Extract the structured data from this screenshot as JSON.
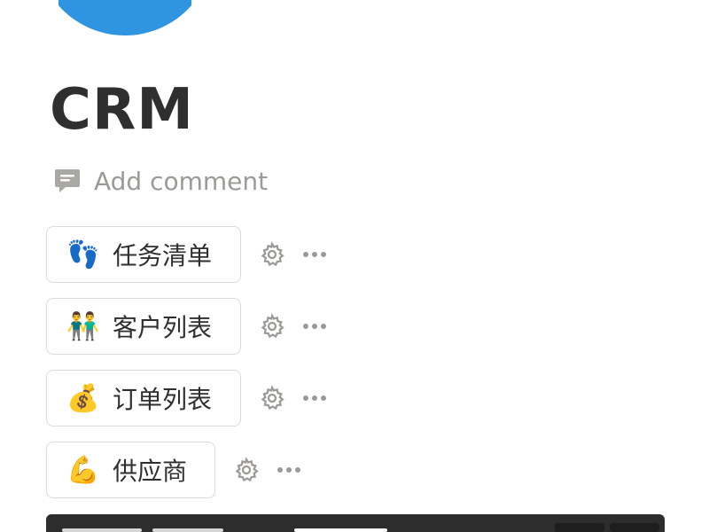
{
  "page": {
    "icon": "globe-icon",
    "title": "CRM",
    "add_comment": "Add comment"
  },
  "links": [
    {
      "emoji": "👣",
      "icon": "footprints-icon",
      "label": "任务清单"
    },
    {
      "emoji": "👬",
      "icon": "people-icon",
      "label": "客户列表"
    },
    {
      "emoji": "💰",
      "icon": "money-bag-icon",
      "label": "订单列表"
    },
    {
      "emoji": "💪",
      "icon": "flexed-biceps-icon",
      "label": "供应商"
    }
  ],
  "colors": {
    "border": "#dcdcdc",
    "muted": "#9b9a97",
    "text": "#2f2f2f",
    "bottom_bar": "#2d2d2d"
  }
}
